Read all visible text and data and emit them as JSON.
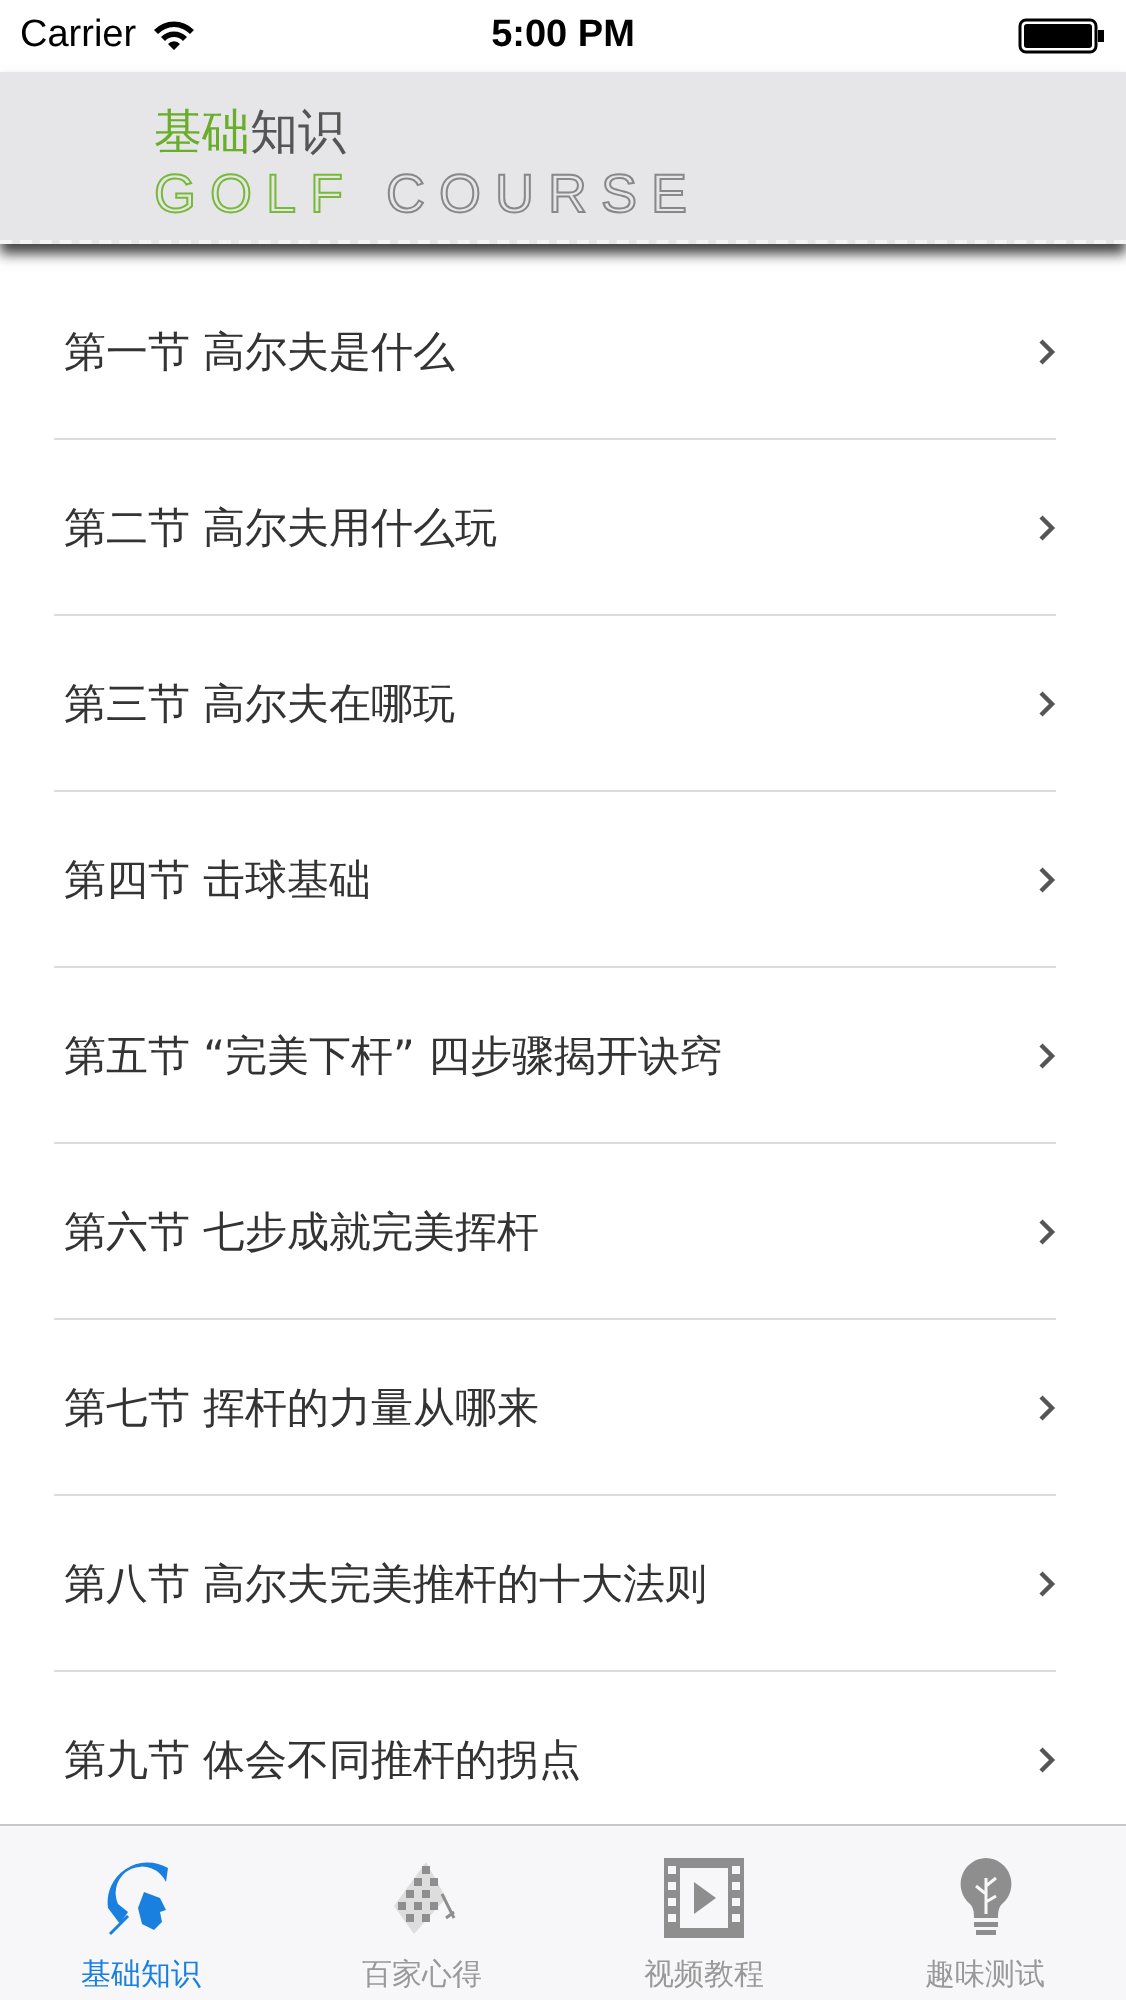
{
  "status_bar": {
    "carrier": "Carrier",
    "time": "5:00 PM"
  },
  "header": {
    "title_parts": [
      "基础",
      "知识"
    ],
    "subtitle_parts": [
      "GOLF",
      "COURSE"
    ]
  },
  "lessons": [
    {
      "label": "第一节 高尔夫是什么"
    },
    {
      "label": "第二节 高尔夫用什么玩"
    },
    {
      "label": "第三节 高尔夫在哪玩"
    },
    {
      "label": "第四节 击球基础"
    },
    {
      "label": "第五节 “完美下杆” 四步骤揭开诀窍"
    },
    {
      "label": "第六节 七步成就完美挥杆"
    },
    {
      "label": "第七节 挥杆的力量从哪来"
    },
    {
      "label": "第八节 高尔夫完美推杆的十大法则"
    },
    {
      "label": "第九节 体会不同推杆的拐点"
    }
  ],
  "tabs": [
    {
      "label": "基础知识",
      "kind": "helmet",
      "selected": true
    },
    {
      "label": "百家心得",
      "kind": "flag",
      "selected": false
    },
    {
      "label": "视频教程",
      "kind": "film",
      "selected": false
    },
    {
      "label": "趣味测试",
      "kind": "bulb",
      "selected": false
    }
  ]
}
